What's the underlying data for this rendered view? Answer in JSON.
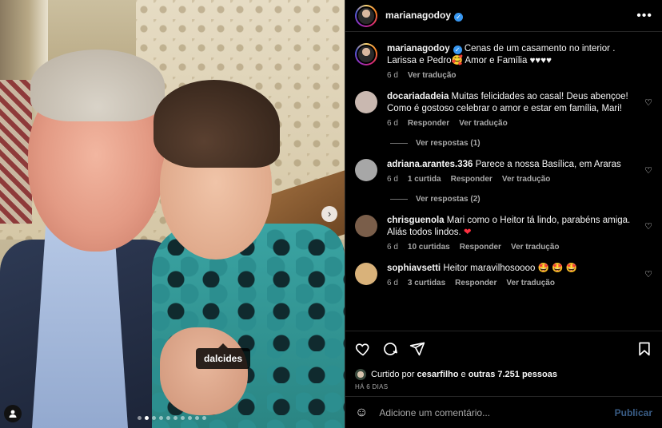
{
  "post": {
    "author": "marianagodoy",
    "photo_tag": "dalcides",
    "carousel_dots": 10,
    "carousel_active": 1
  },
  "caption": {
    "user": "marianagodoy",
    "text": "Cenas de um casamento no interior . Larissa e Pedro🥰 Amor e Família ♥♥♥♥",
    "age": "6 d",
    "translate": "Ver tradução"
  },
  "comments": [
    {
      "user": "docariadadeia",
      "text": "Muitas felicidades ao casal! Deus abençoe! Como é gostoso celebrar o amor e estar em família, Mari!",
      "age": "6 d",
      "likes": "",
      "reply": "Responder",
      "translate": "Ver tradução",
      "replies": "Ver respostas (1)",
      "avatar_color": "#c9b8b0"
    },
    {
      "user": "adriana.arantes.336",
      "text": "Parece a nossa Basílica, em Araras",
      "age": "6 d",
      "likes": "1 curtida",
      "reply": "Responder",
      "translate": "Ver tradução",
      "replies": "Ver respostas (2)",
      "avatar_color": "#a7a7a7"
    },
    {
      "user": "chrisguenola",
      "text": "Mari como o Heitor tá lindo, parabéns amiga. Aliás todos lindos.",
      "heart": "❤",
      "age": "6 d",
      "likes": "10 curtidas",
      "reply": "Responder",
      "translate": "Ver tradução",
      "replies": "",
      "avatar_color": "#7a5e4a"
    },
    {
      "user": "sophiavsetti",
      "text": "Heitor maravilhosoooo 🤩 🤩 🤩",
      "age": "6 d",
      "likes": "3 curtidas",
      "reply": "Responder",
      "translate": "Ver tradução",
      "replies": "",
      "avatar_color": "#d9b27a"
    }
  ],
  "likes": {
    "prefix": "Curtido por",
    "user": "cesarfilho",
    "joiner": "e",
    "others": "outras 7.251 pessoas"
  },
  "date": "HÁ 6 DIAS",
  "composer": {
    "placeholder": "Adicione um comentário...",
    "post_label": "Publicar"
  },
  "colors": {
    "background": "#000000",
    "link_disabled": "#3a5d86",
    "verified": "#3897f0",
    "heart": "#ff3040"
  }
}
